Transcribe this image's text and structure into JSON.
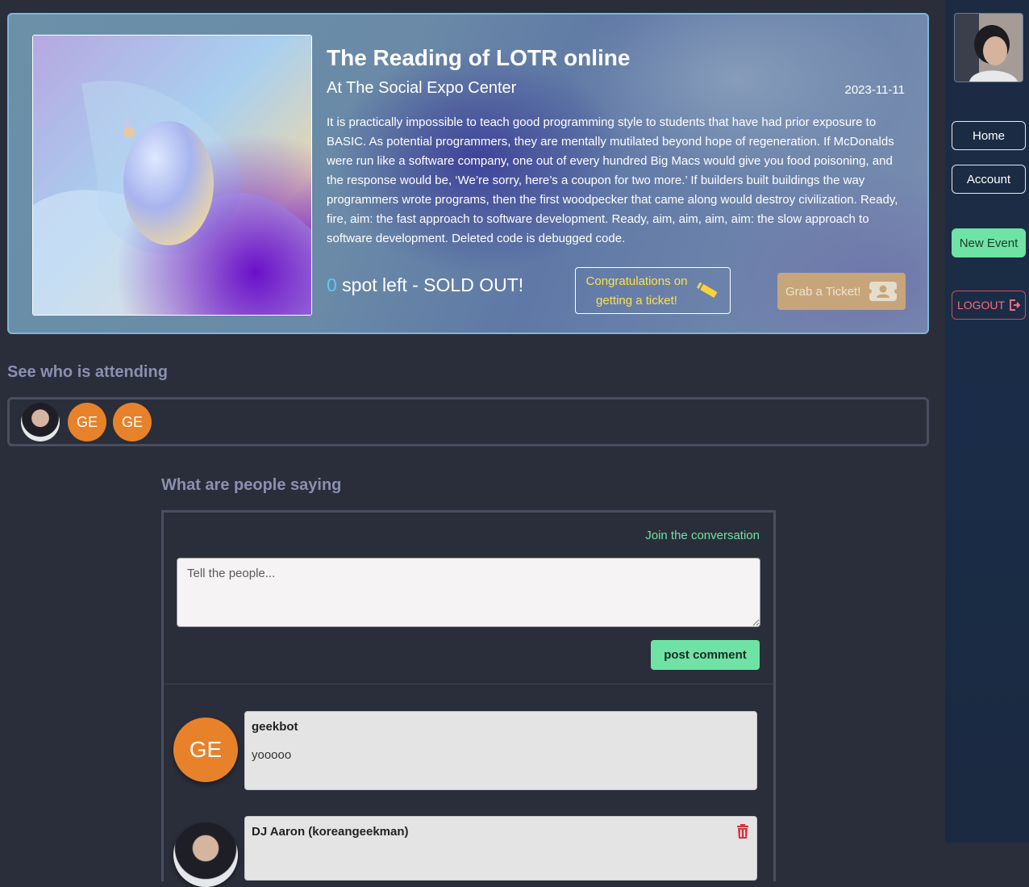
{
  "event": {
    "title": "The Reading of LOTR online",
    "venue": "At The Social Expo Center",
    "date": "2023-11-11",
    "description": "It is practically impossible to teach good programming style to students that have had prior exposure to BASIC. As potential programmers, they are mentally mutilated beyond hope of regeneration. If McDonalds were run like a software company, one out of every hundred Big Macs would give you food poisoning, and the response would be, ‘We’re sorry, here’s a coupon for two more.’ If builders built buildings the way programmers wrote programs, then the first woodpecker that came along would destroy civilization. Ready, fire, aim: the fast approach to software development. Ready, aim, aim, aim, aim: the slow approach to software development. Deleted code is debugged code.",
    "spots_count": "0",
    "spots_text": " spot left - SOLD OUT!",
    "congrats_label": "Congratulations on getting a ticket!",
    "grab_label": "Grab a Ticket!"
  },
  "sidebar": {
    "home": "Home",
    "account": "Account",
    "new_event": "New Event",
    "logout": "LOGOUT"
  },
  "attending": {
    "title": "See who is attending",
    "attendees": [
      {
        "initials": ""
      },
      {
        "initials": "GE"
      },
      {
        "initials": "GE"
      }
    ]
  },
  "comments": {
    "title": "What are people saying",
    "join_label": "Join the conversation",
    "input_placeholder": "Tell the people...",
    "post_label": "post comment",
    "items": [
      {
        "initials": "GE",
        "author": "geekbot",
        "text": "yooooo"
      },
      {
        "initials": "",
        "author": "DJ Aaron (koreangeekman)",
        "text": ""
      }
    ]
  },
  "colors": {
    "accent_green": "#6fe3a5",
    "accent_orange": "#e8822a",
    "logout_red": "#d94a5a",
    "spots_blue": "#5fc8f0",
    "congrats_yellow": "#ffe14a"
  }
}
